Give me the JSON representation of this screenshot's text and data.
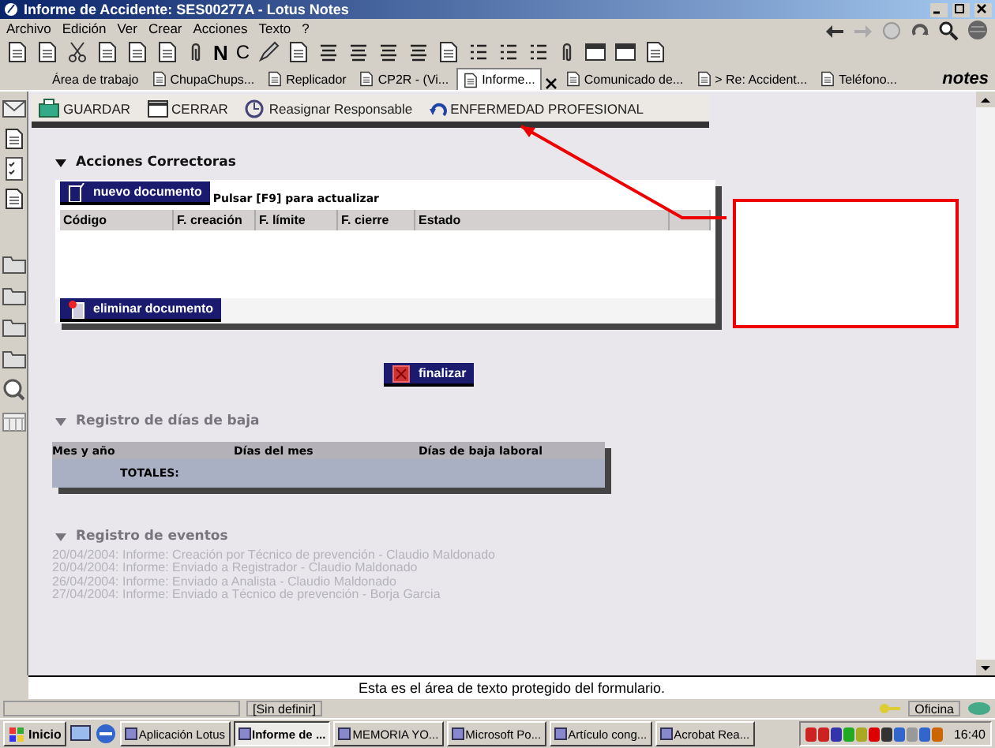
{
  "window": {
    "title": "Informe de Accidente: SES00277A - Lotus Notes"
  },
  "menu": [
    "Archivo",
    "Edición",
    "Ver",
    "Crear",
    "Acciones",
    "Texto",
    "?"
  ],
  "toolbar": [
    {
      "kind": "icon"
    },
    {
      "kind": "icon"
    },
    {
      "kind": "icon"
    },
    {
      "kind": "icon"
    },
    {
      "kind": "icon"
    },
    {
      "kind": "icon"
    },
    {
      "kind": "icon"
    },
    {
      "kind": "letter",
      "text": "N"
    },
    {
      "kind": "letter",
      "text": "C"
    },
    {
      "kind": "icon"
    },
    {
      "kind": "icon"
    },
    {
      "kind": "icon"
    },
    {
      "kind": "icon"
    },
    {
      "kind": "icon"
    },
    {
      "kind": "icon"
    },
    {
      "kind": "icon"
    },
    {
      "kind": "icon"
    },
    {
      "kind": "icon"
    },
    {
      "kind": "icon"
    },
    {
      "kind": "icon"
    },
    {
      "kind": "icon"
    },
    {
      "kind": "icon"
    },
    {
      "kind": "icon"
    }
  ],
  "tabs": [
    {
      "label": "Área de trabajo",
      "selected": false
    },
    {
      "label": "ChupaChups...",
      "selected": false
    },
    {
      "label": "Replicador",
      "selected": false
    },
    {
      "label": "CP2R - (Vi...",
      "selected": false
    },
    {
      "label": "Informe...",
      "selected": true
    },
    {
      "label": "Comunicado de...",
      "selected": false
    },
    {
      "label": "> Re: Accident...",
      "selected": false
    },
    {
      "label": "Teléfono...",
      "selected": false
    }
  ],
  "brand": "notes",
  "action_bar": [
    "GUARDAR",
    "CERRAR",
    "Reasignar Responsable",
    "ENFERMEDAD PROFESIONAL"
  ],
  "corrective_actions": {
    "title": "Acciones Correctoras",
    "new_button": "nuevo documento",
    "hint": "Pulsar [F9] para actualizar",
    "columns": [
      "Código",
      "F. creación",
      "F. límite",
      "F. cierre",
      "Estado"
    ],
    "delete_button": "eliminar documento"
  },
  "finish_button": "finalizar",
  "sick_leave": {
    "title": "Registro de días de baja",
    "columns": [
      "Mes y año",
      "Días del mes",
      "Días de baja laboral"
    ],
    "totals_label": "TOTALES:"
  },
  "events": {
    "title": "Registro de eventos",
    "entries": [
      "20/04/2004: Informe: Creación por Técnico de prevención - Claudio Maldonado",
      "20/04/2004: Informe: Enviado a Registrador - Claudio Maldonado",
      "26/04/2004: Informe: Enviado a Analista - Claudio Maldonado",
      "27/04/2004: Informe: Enviado a Técnico de prevención - Borja Garcia"
    ]
  },
  "protected_text": "Esta es el área de texto protegido del formulario.",
  "status_bar": {
    "fields": [
      "[Sin definir]"
    ],
    "location": "Oficina"
  },
  "taskbar": {
    "start": "Inicio",
    "tasks": [
      {
        "label": "Aplicación Lotus",
        "selected": false
      },
      {
        "label": "Informe de ...",
        "selected": true
      },
      {
        "label": "MEMORIA YO...",
        "selected": false
      },
      {
        "label": "Microsoft Po...",
        "selected": false
      },
      {
        "label": "Artículo cong...",
        "selected": false
      },
      {
        "label": "Acrobat Rea...",
        "selected": false
      }
    ],
    "clock": "16:40"
  }
}
